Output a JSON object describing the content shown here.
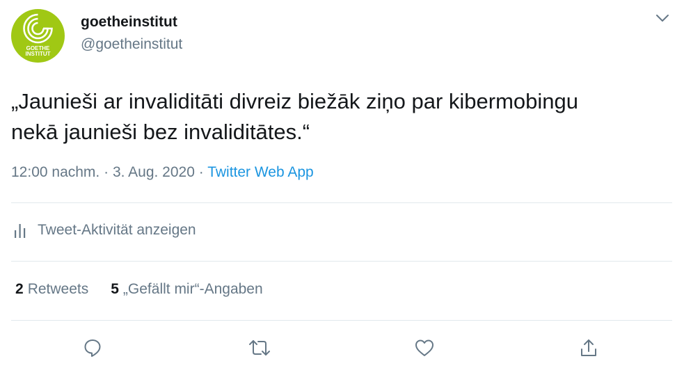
{
  "tweet": {
    "avatar": {
      "brand_line1": "GOETHE",
      "brand_line2": "INSTITUT",
      "color": "#a0c814"
    },
    "display_name": "goetheinstitut",
    "handle": "@goetheinstitut",
    "text": "„Jaunieši ar invaliditāti divreiz biežāk ziņo par kibermobingu\n nekā jaunieši bez invaliditātes.“",
    "time": "12:00 nachm.",
    "separator": " · ",
    "date": "3. Aug. 2020",
    "source": "Twitter Web App",
    "activity_label": "Tweet-Aktivität anzeigen",
    "retweets_count": "2",
    "retweets_label": "Retweets",
    "likes_count": "5",
    "likes_label": "„Gefällt mir“-Angaben"
  },
  "icons": {
    "caret": "chevron-down-icon",
    "activity": "bar-chart-icon",
    "reply": "reply-icon",
    "retweet": "retweet-icon",
    "like": "heart-icon",
    "share": "share-icon"
  },
  "colors": {
    "text": "#14171a",
    "secondary": "#657786",
    "link": "#1b95e0",
    "divider": "#e1e8ed"
  }
}
